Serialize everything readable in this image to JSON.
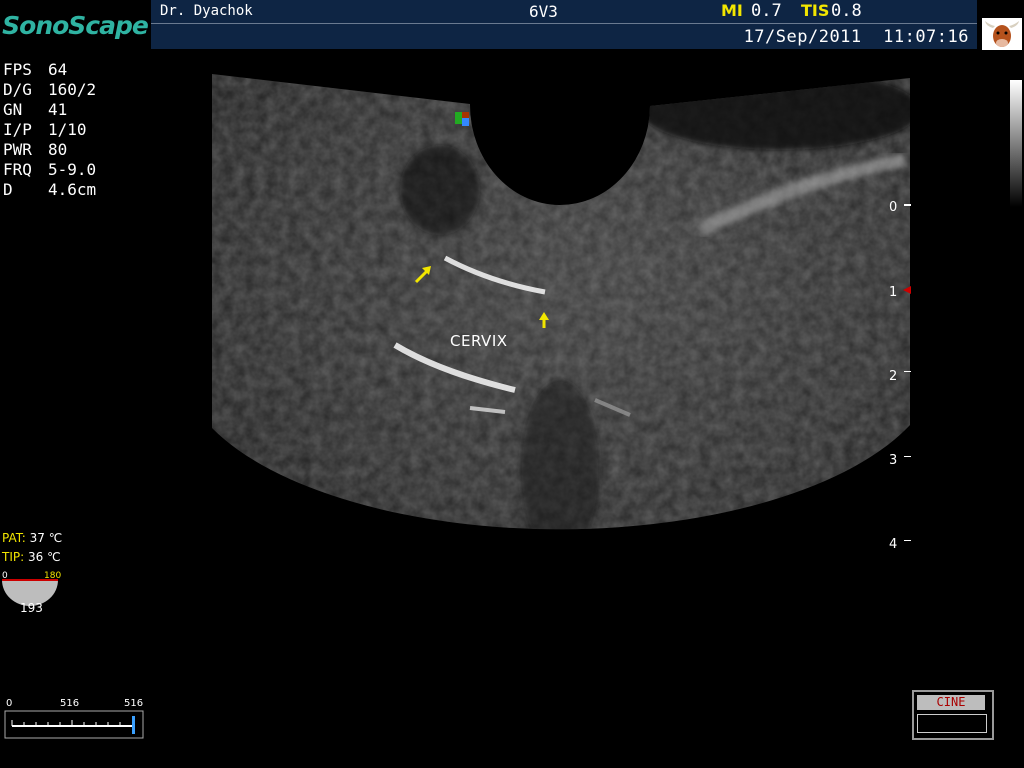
{
  "header": {
    "logo": "SonoScape",
    "doctor": "Dr. Dyachok",
    "probe": "6V3",
    "mi_label": "MI",
    "mi_value": "0.7",
    "tis_label": "TIS",
    "tis_value": "0.8",
    "datetime": "17/Sep/2011  11:07:16",
    "icon": "cow-icon"
  },
  "params": [
    {
      "key": "FPS",
      "value": "64"
    },
    {
      "key": "D/G",
      "value": "160/2"
    },
    {
      "key": "GN",
      "value": "41"
    },
    {
      "key": "I/P",
      "value": "1/10"
    },
    {
      "key": "PWR",
      "value": "80"
    },
    {
      "key": "FRQ",
      "value": "5-9.0"
    },
    {
      "key": "D",
      "value": "4.6cm"
    }
  ],
  "temps": {
    "pat_label": "PAT:",
    "pat_value": "37 ℃",
    "tip_label": "TIP:",
    "tip_value": "36 ℃"
  },
  "angle": {
    "min": "0",
    "max": "180",
    "value": "193"
  },
  "cine_bar": {
    "start": "0",
    "mid": "516",
    "end": "516"
  },
  "cine": {
    "label": "CINE"
  },
  "depth_scale": [
    "0",
    "1",
    "2",
    "3",
    "4"
  ],
  "annotation": {
    "label": "CERVIX"
  },
  "colors": {
    "header_bg": "#0e2544",
    "logo": "#2fb3a2",
    "accent_yellow": "#f2e600",
    "marker_red": "#cc0000"
  }
}
